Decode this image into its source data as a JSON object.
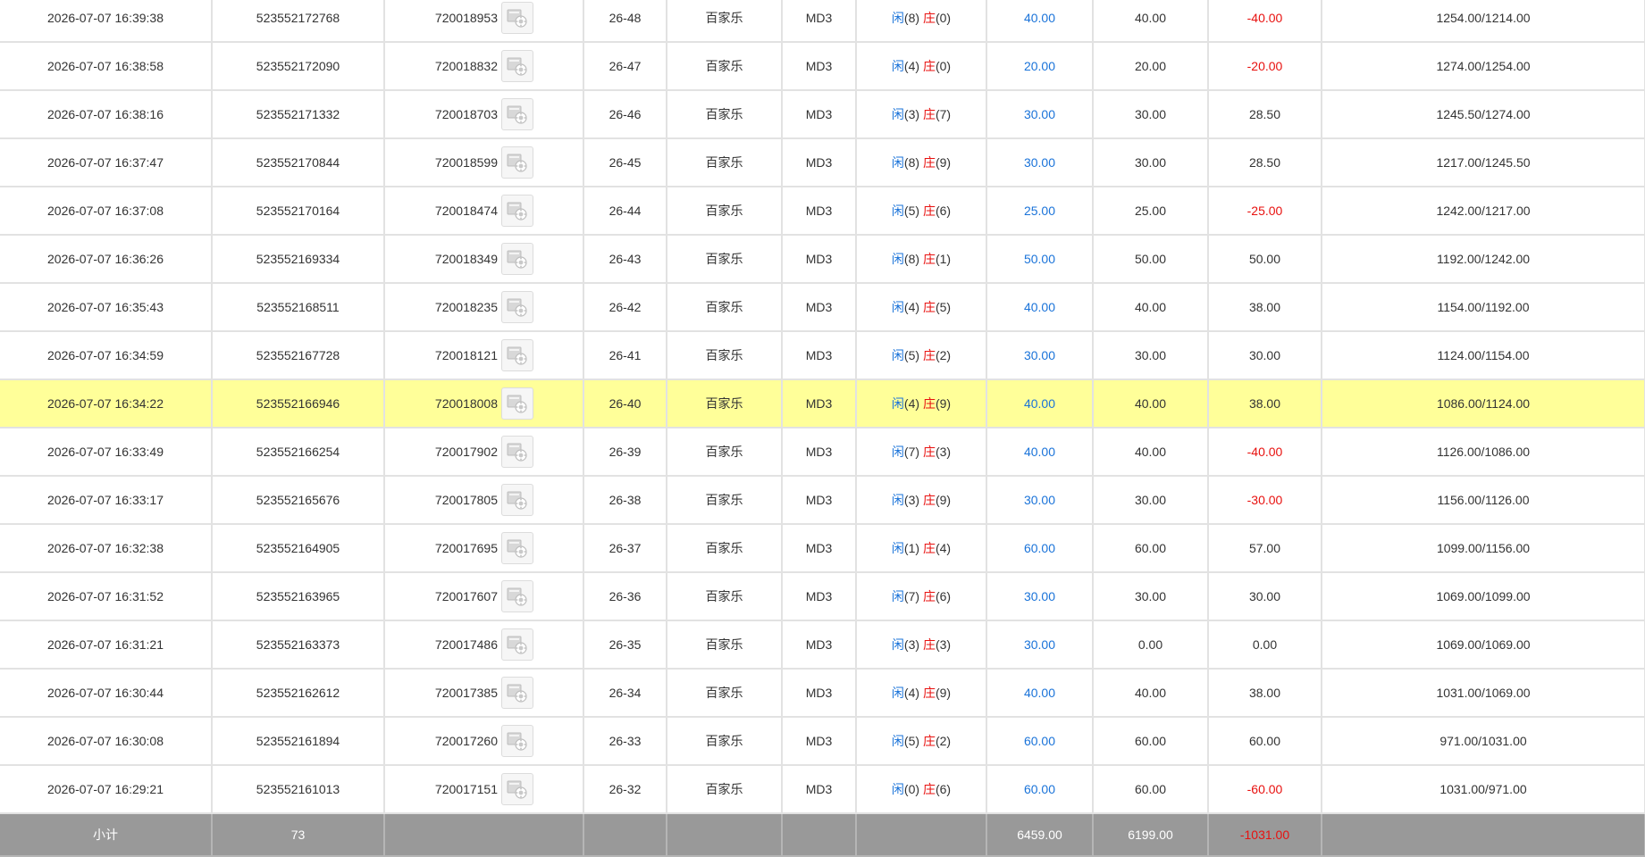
{
  "rows": [
    {
      "time": "2026-07-07 16:39:38",
      "order": "523552172768",
      "round": "720018953",
      "shoe": "26-48",
      "game": "百家乐",
      "table": "MD3",
      "player": "8",
      "banker": "0",
      "bet": "40.00",
      "valid": "40.00",
      "win": "-40.00",
      "win_neg": true,
      "balance": "1254.00/1214.00",
      "highlight": false
    },
    {
      "time": "2026-07-07 16:38:58",
      "order": "523552172090",
      "round": "720018832",
      "shoe": "26-47",
      "game": "百家乐",
      "table": "MD3",
      "player": "4",
      "banker": "0",
      "bet": "20.00",
      "valid": "20.00",
      "win": "-20.00",
      "win_neg": true,
      "balance": "1274.00/1254.00",
      "highlight": false
    },
    {
      "time": "2026-07-07 16:38:16",
      "order": "523552171332",
      "round": "720018703",
      "shoe": "26-46",
      "game": "百家乐",
      "table": "MD3",
      "player": "3",
      "banker": "7",
      "bet": "30.00",
      "valid": "30.00",
      "win": "28.50",
      "win_neg": false,
      "balance": "1245.50/1274.00",
      "highlight": false
    },
    {
      "time": "2026-07-07 16:37:47",
      "order": "523552170844",
      "round": "720018599",
      "shoe": "26-45",
      "game": "百家乐",
      "table": "MD3",
      "player": "8",
      "banker": "9",
      "bet": "30.00",
      "valid": "30.00",
      "win": "28.50",
      "win_neg": false,
      "balance": "1217.00/1245.50",
      "highlight": false
    },
    {
      "time": "2026-07-07 16:37:08",
      "order": "523552170164",
      "round": "720018474",
      "shoe": "26-44",
      "game": "百家乐",
      "table": "MD3",
      "player": "5",
      "banker": "6",
      "bet": "25.00",
      "valid": "25.00",
      "win": "-25.00",
      "win_neg": true,
      "balance": "1242.00/1217.00",
      "highlight": false
    },
    {
      "time": "2026-07-07 16:36:26",
      "order": "523552169334",
      "round": "720018349",
      "shoe": "26-43",
      "game": "百家乐",
      "table": "MD3",
      "player": "8",
      "banker": "1",
      "bet": "50.00",
      "valid": "50.00",
      "win": "50.00",
      "win_neg": false,
      "balance": "1192.00/1242.00",
      "highlight": false
    },
    {
      "time": "2026-07-07 16:35:43",
      "order": "523552168511",
      "round": "720018235",
      "shoe": "26-42",
      "game": "百家乐",
      "table": "MD3",
      "player": "4",
      "banker": "5",
      "bet": "40.00",
      "valid": "40.00",
      "win": "38.00",
      "win_neg": false,
      "balance": "1154.00/1192.00",
      "highlight": false
    },
    {
      "time": "2026-07-07 16:34:59",
      "order": "523552167728",
      "round": "720018121",
      "shoe": "26-41",
      "game": "百家乐",
      "table": "MD3",
      "player": "5",
      "banker": "2",
      "bet": "30.00",
      "valid": "30.00",
      "win": "30.00",
      "win_neg": false,
      "balance": "1124.00/1154.00",
      "highlight": false
    },
    {
      "time": "2026-07-07 16:34:22",
      "order": "523552166946",
      "round": "720018008",
      "shoe": "26-40",
      "game": "百家乐",
      "table": "MD3",
      "player": "4",
      "banker": "9",
      "bet": "40.00",
      "valid": "40.00",
      "win": "38.00",
      "win_neg": false,
      "balance": "1086.00/1124.00",
      "highlight": true
    },
    {
      "time": "2026-07-07 16:33:49",
      "order": "523552166254",
      "round": "720017902",
      "shoe": "26-39",
      "game": "百家乐",
      "table": "MD3",
      "player": "7",
      "banker": "3",
      "bet": "40.00",
      "valid": "40.00",
      "win": "-40.00",
      "win_neg": true,
      "balance": "1126.00/1086.00",
      "highlight": false
    },
    {
      "time": "2026-07-07 16:33:17",
      "order": "523552165676",
      "round": "720017805",
      "shoe": "26-38",
      "game": "百家乐",
      "table": "MD3",
      "player": "3",
      "banker": "9",
      "bet": "30.00",
      "valid": "30.00",
      "win": "-30.00",
      "win_neg": true,
      "balance": "1156.00/1126.00",
      "highlight": false
    },
    {
      "time": "2026-07-07 16:32:38",
      "order": "523552164905",
      "round": "720017695",
      "shoe": "26-37",
      "game": "百家乐",
      "table": "MD3",
      "player": "1",
      "banker": "4",
      "bet": "60.00",
      "valid": "60.00",
      "win": "57.00",
      "win_neg": false,
      "balance": "1099.00/1156.00",
      "highlight": false
    },
    {
      "time": "2026-07-07 16:31:52",
      "order": "523552163965",
      "round": "720017607",
      "shoe": "26-36",
      "game": "百家乐",
      "table": "MD3",
      "player": "7",
      "banker": "6",
      "bet": "30.00",
      "valid": "30.00",
      "win": "30.00",
      "win_neg": false,
      "balance": "1069.00/1099.00",
      "highlight": false
    },
    {
      "time": "2026-07-07 16:31:21",
      "order": "523552163373",
      "round": "720017486",
      "shoe": "26-35",
      "game": "百家乐",
      "table": "MD3",
      "player": "3",
      "banker": "3",
      "bet": "30.00",
      "valid": "0.00",
      "win": "0.00",
      "win_neg": false,
      "balance": "1069.00/1069.00",
      "highlight": false
    },
    {
      "time": "2026-07-07 16:30:44",
      "order": "523552162612",
      "round": "720017385",
      "shoe": "26-34",
      "game": "百家乐",
      "table": "MD3",
      "player": "4",
      "banker": "9",
      "bet": "40.00",
      "valid": "40.00",
      "win": "38.00",
      "win_neg": false,
      "balance": "1031.00/1069.00",
      "highlight": false
    },
    {
      "time": "2026-07-07 16:30:08",
      "order": "523552161894",
      "round": "720017260",
      "shoe": "26-33",
      "game": "百家乐",
      "table": "MD3",
      "player": "5",
      "banker": "2",
      "bet": "60.00",
      "valid": "60.00",
      "win": "60.00",
      "win_neg": false,
      "balance": "971.00/1031.00",
      "highlight": false
    },
    {
      "time": "2026-07-07 16:29:21",
      "order": "523552161013",
      "round": "720017151",
      "shoe": "26-32",
      "game": "百家乐",
      "table": "MD3",
      "player": "0",
      "banker": "6",
      "bet": "60.00",
      "valid": "60.00",
      "win": "-60.00",
      "win_neg": true,
      "balance": "1031.00/971.00",
      "highlight": false
    }
  ],
  "labels": {
    "player": "闲",
    "banker": "庄"
  },
  "summary": {
    "label": "小计",
    "count": "73",
    "bet": "6459.00",
    "valid": "6199.00",
    "win": "-1031.00"
  },
  "icons": {
    "replay": "video-replay-icon"
  },
  "colors": {
    "accent_blue": "#1a73d9",
    "negative_red": "#e8110f",
    "highlight": "#ffff99",
    "summary_bg": "#999999"
  }
}
